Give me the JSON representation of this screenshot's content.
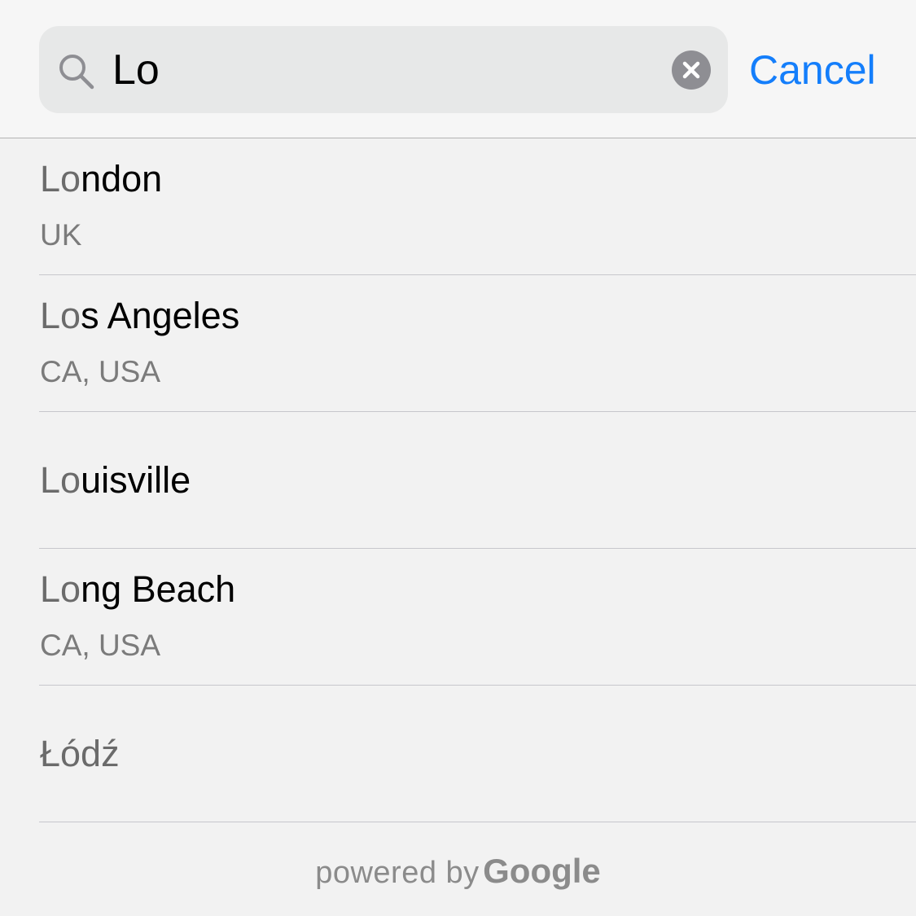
{
  "search": {
    "value": "Lo",
    "cancel_label": "Cancel"
  },
  "results": [
    {
      "match": "Lo",
      "rest": "ndon",
      "subtitle": "UK"
    },
    {
      "match": "Lo",
      "rest": "s Angeles",
      "subtitle": "CA, USA"
    },
    {
      "match": "Lo",
      "rest": "uisville",
      "subtitle": ""
    },
    {
      "match": "Lo",
      "rest": "ng Beach",
      "subtitle": "CA, USA"
    },
    {
      "match": "",
      "rest": "Łódź",
      "subtitle": ""
    }
  ],
  "footer": {
    "powered_by": "powered by",
    "brand": "Google"
  },
  "colors": {
    "accent": "#147efb",
    "match_text": "#6b6b6b",
    "subtitle_text": "#7b7b7b",
    "background": "#f2f2f2"
  }
}
